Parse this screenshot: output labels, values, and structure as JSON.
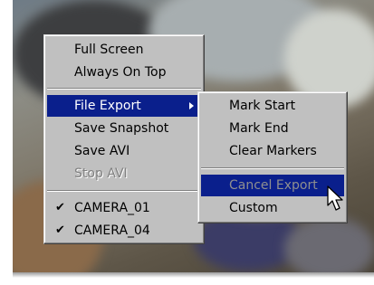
{
  "main_menu": {
    "items": [
      {
        "label": "Full Screen"
      },
      {
        "label": "Always On Top"
      },
      {
        "label": "File Export"
      },
      {
        "label": "Save Snapshot"
      },
      {
        "label": "Save AVI"
      },
      {
        "label": "Stop AVI"
      },
      {
        "label": "CAMERA_01"
      },
      {
        "label": "CAMERA_04"
      }
    ]
  },
  "sub_menu": {
    "items": [
      {
        "label": "Mark Start"
      },
      {
        "label": "Mark End"
      },
      {
        "label": "Clear Markers"
      },
      {
        "label": "Cancel Export"
      },
      {
        "label": "Custom"
      }
    ]
  },
  "icons": {
    "checkmark": "check-icon",
    "submenu_arrow": "submenu-arrow-icon",
    "cursor": "mouse-cursor-icon"
  },
  "colors": {
    "highlight": "#0a1f8c",
    "menu_face": "#c0c0c0",
    "disabled_text": "#808080"
  }
}
